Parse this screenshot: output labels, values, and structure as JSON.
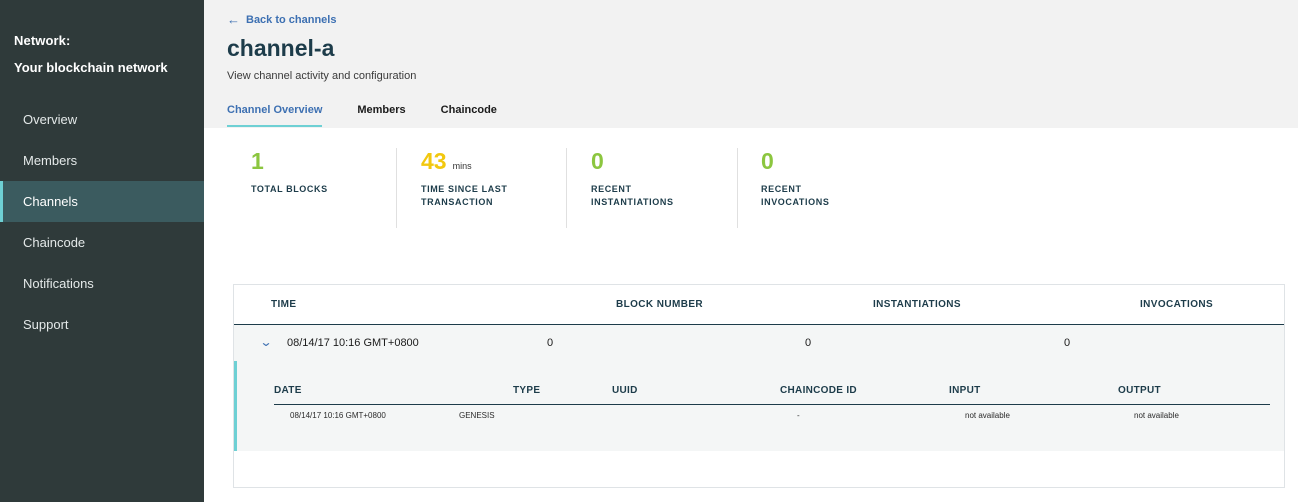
{
  "sidebar": {
    "network_label": "Network:",
    "network_name": "Your blockchain network",
    "items": [
      {
        "label": "Overview"
      },
      {
        "label": "Members"
      },
      {
        "label": "Channels"
      },
      {
        "label": "Chaincode"
      },
      {
        "label": "Notifications"
      },
      {
        "label": "Support"
      }
    ],
    "active_item": "Channels"
  },
  "header": {
    "back_label": "Back to channels",
    "title": "channel-a",
    "description": "View channel activity and configuration",
    "tabs": [
      {
        "label": "Channel Overview"
      },
      {
        "label": "Members"
      },
      {
        "label": "Chaincode"
      }
    ],
    "active_tab": "Channel Overview"
  },
  "stats": [
    {
      "value": "1",
      "unit": "",
      "label": "TOTAL BLOCKS",
      "color": "#8cc63f"
    },
    {
      "value": "43",
      "unit": "mins",
      "label": "TIME SINCE LAST\nTRANSACTION",
      "color": "#f2c80f"
    },
    {
      "value": "0",
      "unit": "",
      "label": "RECENT\nINSTANTIATIONS",
      "color": "#8cc63f"
    },
    {
      "value": "0",
      "unit": "",
      "label": "RECENT\nINVOCATIONS",
      "color": "#8cc63f"
    }
  ],
  "table": {
    "headers": [
      "TIME",
      "BLOCK NUMBER",
      "INSTANTIATIONS",
      "INVOCATIONS"
    ],
    "rows": [
      {
        "time": "08/14/17 10:16 GMT+0800",
        "block_number": "0",
        "instantiations": "0",
        "invocations": "0",
        "expanded": true,
        "detail": {
          "headers": [
            "DATE",
            "TYPE",
            "UUID",
            "CHAINCODE ID",
            "INPUT",
            "OUTPUT"
          ],
          "rows": [
            {
              "date": "08/14/17 10:16 GMT+0800",
              "type": "GENESIS",
              "uuid": "",
              "chaincode_id": "-",
              "input": "not available",
              "output": "not available"
            }
          ]
        }
      }
    ]
  },
  "colors": {
    "sidebar_bg": "#2f3a3a",
    "sidebar_active": "#3b5b5f",
    "accent_teal": "#6ed0d4",
    "link_blue": "#3d70b2",
    "stat_green": "#8cc63f",
    "stat_yellow": "#f2c80f"
  }
}
